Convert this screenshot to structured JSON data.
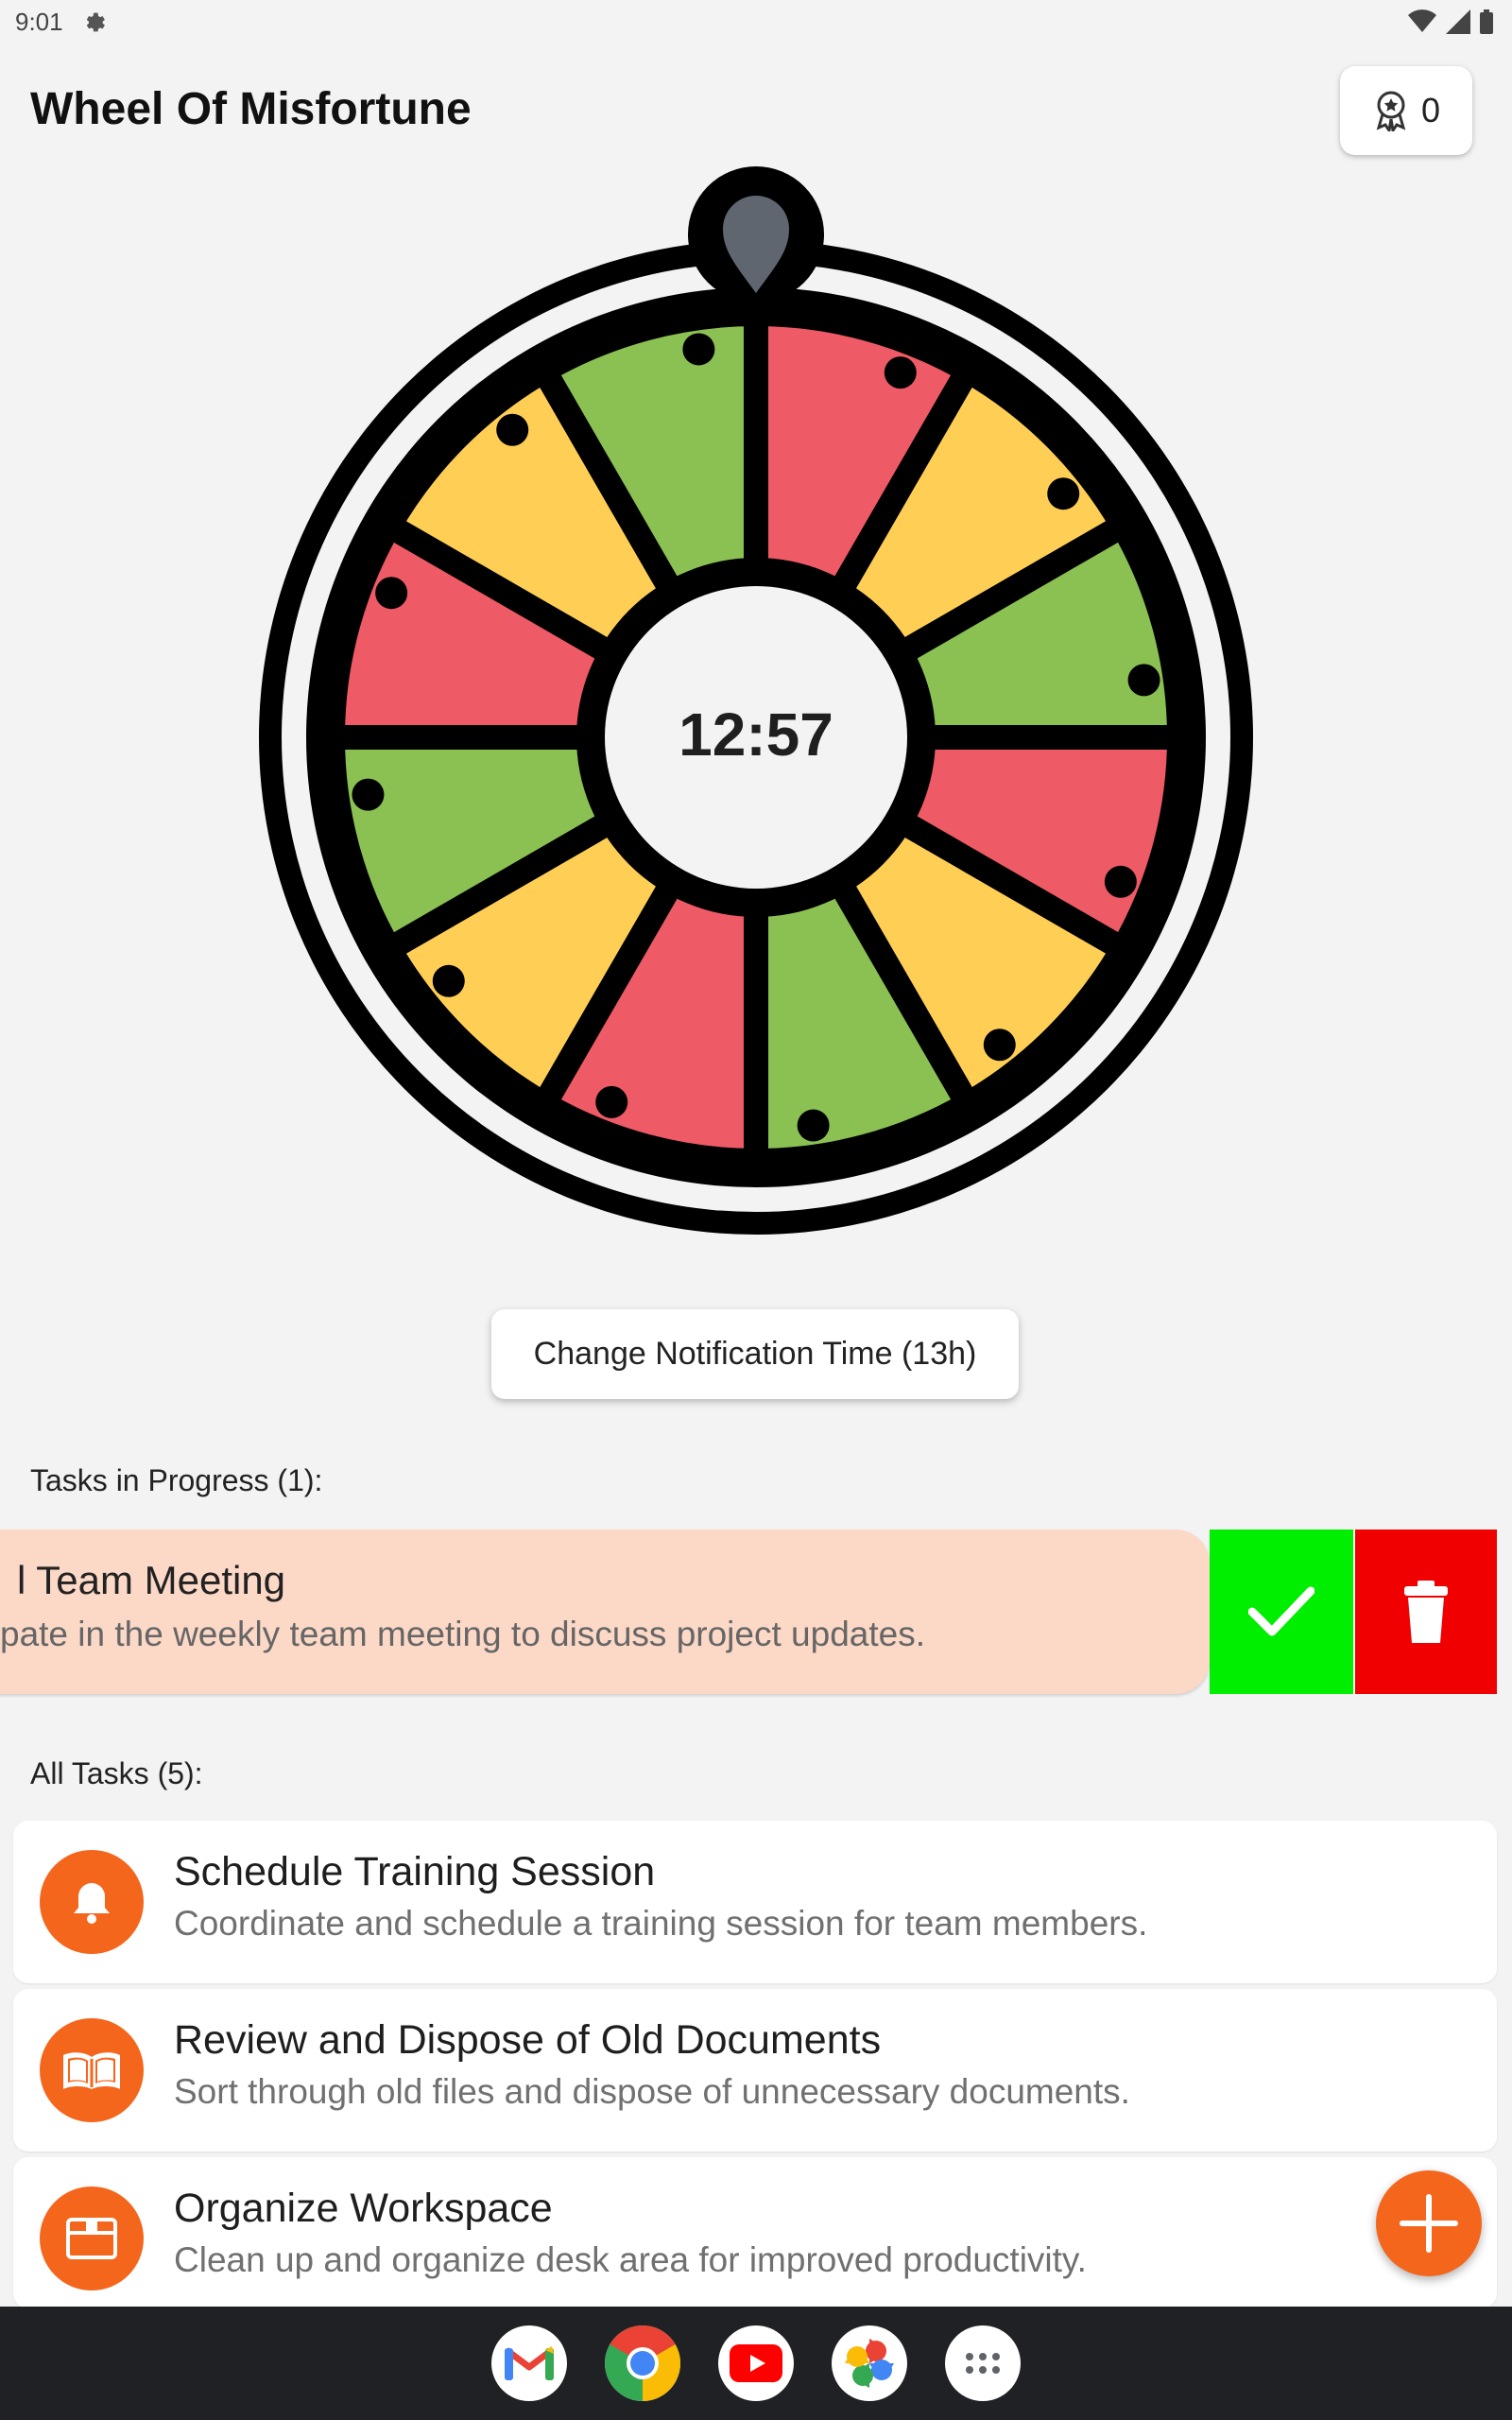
{
  "status_bar": {
    "time": "9:01"
  },
  "header": {
    "title": "Wheel Of Misfortune",
    "badge_count": "0"
  },
  "wheel": {
    "center_time": "12:57",
    "segment_colors": [
      "#ee5a66",
      "#ffcf55",
      "#8bc152",
      "#ee5a66",
      "#ffcf55",
      "#8bc152",
      "#ee5a66",
      "#ffcf55",
      "#8bc152",
      "#ee5a66",
      "#ffcf55",
      "#8bc152"
    ],
    "pointer_color": "#5f6670"
  },
  "notification_button": {
    "label": "Change Notification Time (13h)"
  },
  "in_progress": {
    "label": "Tasks in Progress (1):",
    "task": {
      "title": "l Team Meeting",
      "description": "pate in the weekly team meeting to discuss project updates."
    }
  },
  "all_tasks": {
    "label": "All Tasks (5):",
    "items": [
      {
        "title": "Schedule Training Session",
        "description": "Coordinate and schedule a training session for team members.",
        "icon": "bell-icon"
      },
      {
        "title": "Review and Dispose of Old Documents",
        "description": "Sort through old files and dispose of unnecessary documents.",
        "icon": "book-icon"
      },
      {
        "title": "Organize Workspace",
        "description": "Clean up and organize desk area for improved productivity.",
        "icon": "box-icon"
      }
    ]
  },
  "dock": {
    "apps": [
      "gmail-icon",
      "chrome-icon",
      "youtube-icon",
      "photos-icon",
      "app-drawer-icon"
    ]
  },
  "colors": {
    "accent": "#f5661d",
    "complete": "#00ee00",
    "delete": "#f00000",
    "progress_card": "#fcd8c7"
  }
}
